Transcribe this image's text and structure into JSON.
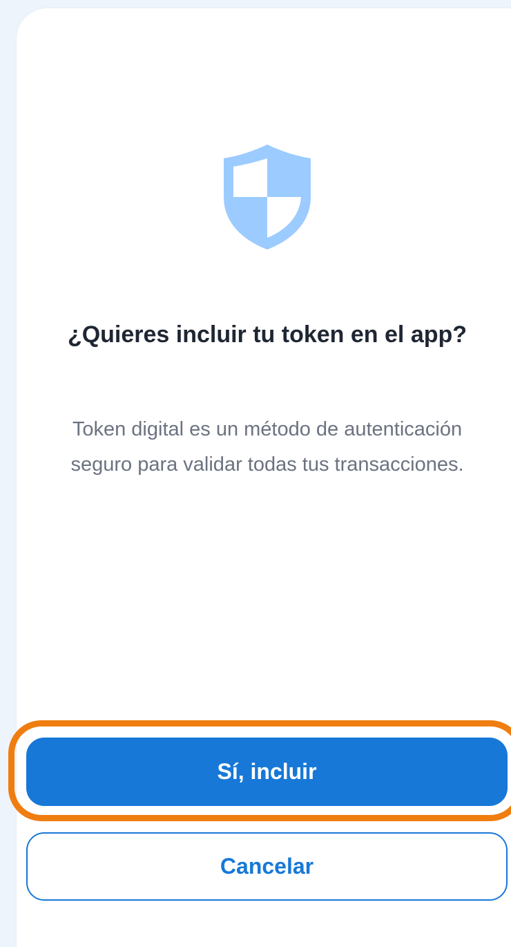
{
  "dialog": {
    "icon": "shield-icon",
    "title": "¿Quieres incluir tu token en el app?",
    "description": "Token digital es un método de autenticación seguro para validar todas tus transacciones.",
    "confirm_label": "Sí, incluir",
    "cancel_label": "Cancelar"
  },
  "colors": {
    "primary": "#1778d8",
    "highlight": "#f07d0f",
    "shield_light": "#9ccbff",
    "title_text": "#1f2633",
    "body_text": "#6b7280"
  }
}
